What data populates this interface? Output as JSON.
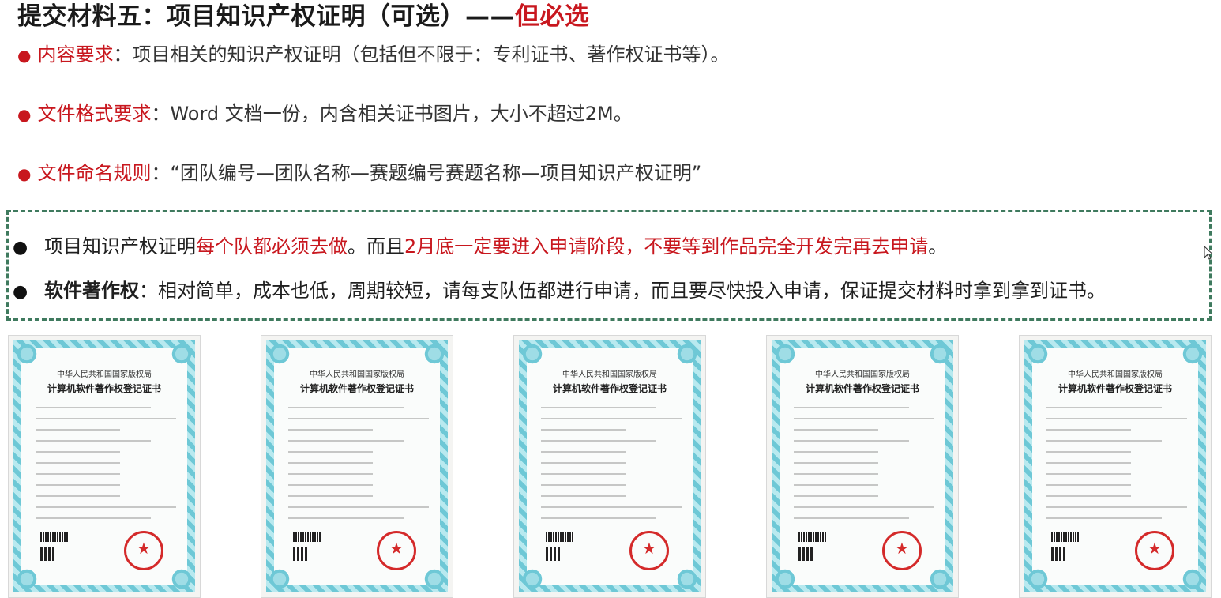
{
  "heading": {
    "main": "提交材料五：项目知识产权证明（可选）——",
    "accent": "但必选"
  },
  "requirements": [
    {
      "label": "内容要求",
      "sep": "：",
      "text": "项目相关的知识产权证明（包括但不限于：专利证书、著作权证书等）。"
    },
    {
      "label": "文件格式要求",
      "sep": "：",
      "text": "Word 文档一份，内含相关证书图片，大小不超过2M。"
    },
    {
      "label": "文件命名规则",
      "sep": "：",
      "text": "“团队编号—团队名称—赛题编号赛题名称—项目知识产权证明”"
    }
  ],
  "notes": {
    "line1": {
      "a": "项目知识产权证明",
      "b": "每个队都必须去做",
      "c": "。而且",
      "d": "2月底一定要进入申请阶段，不要等到作品完全开发完再去申请",
      "e": "。"
    },
    "line2": {
      "a": "软件著作权",
      "b": "：相对简单，成本也低，周期较短，请每支队伍都进行申请，而且要尽快投入申请，保证提交材料时拿到拿到证书。"
    }
  },
  "certificates": [
    {
      "org": "中华人民共和国国家版权局",
      "title": "计算机软件著作权登记证书"
    },
    {
      "org": "中华人民共和国国家版权局",
      "title": "计算机软件著作权登记证书"
    },
    {
      "org": "中华人民共和国国家版权局",
      "title": "计算机软件著作权登记证书"
    },
    {
      "org": "中华人民共和国国家版权局",
      "title": "计算机软件著作权登记证书"
    },
    {
      "org": "中华人民共和国国家版权局",
      "title": "计算机软件著作权登记证书"
    }
  ],
  "colors": {
    "accent": "#c8171e",
    "box_border": "#3f7a5e",
    "cert_frame": "#6ec8d6",
    "seal": "#d42a2a"
  }
}
